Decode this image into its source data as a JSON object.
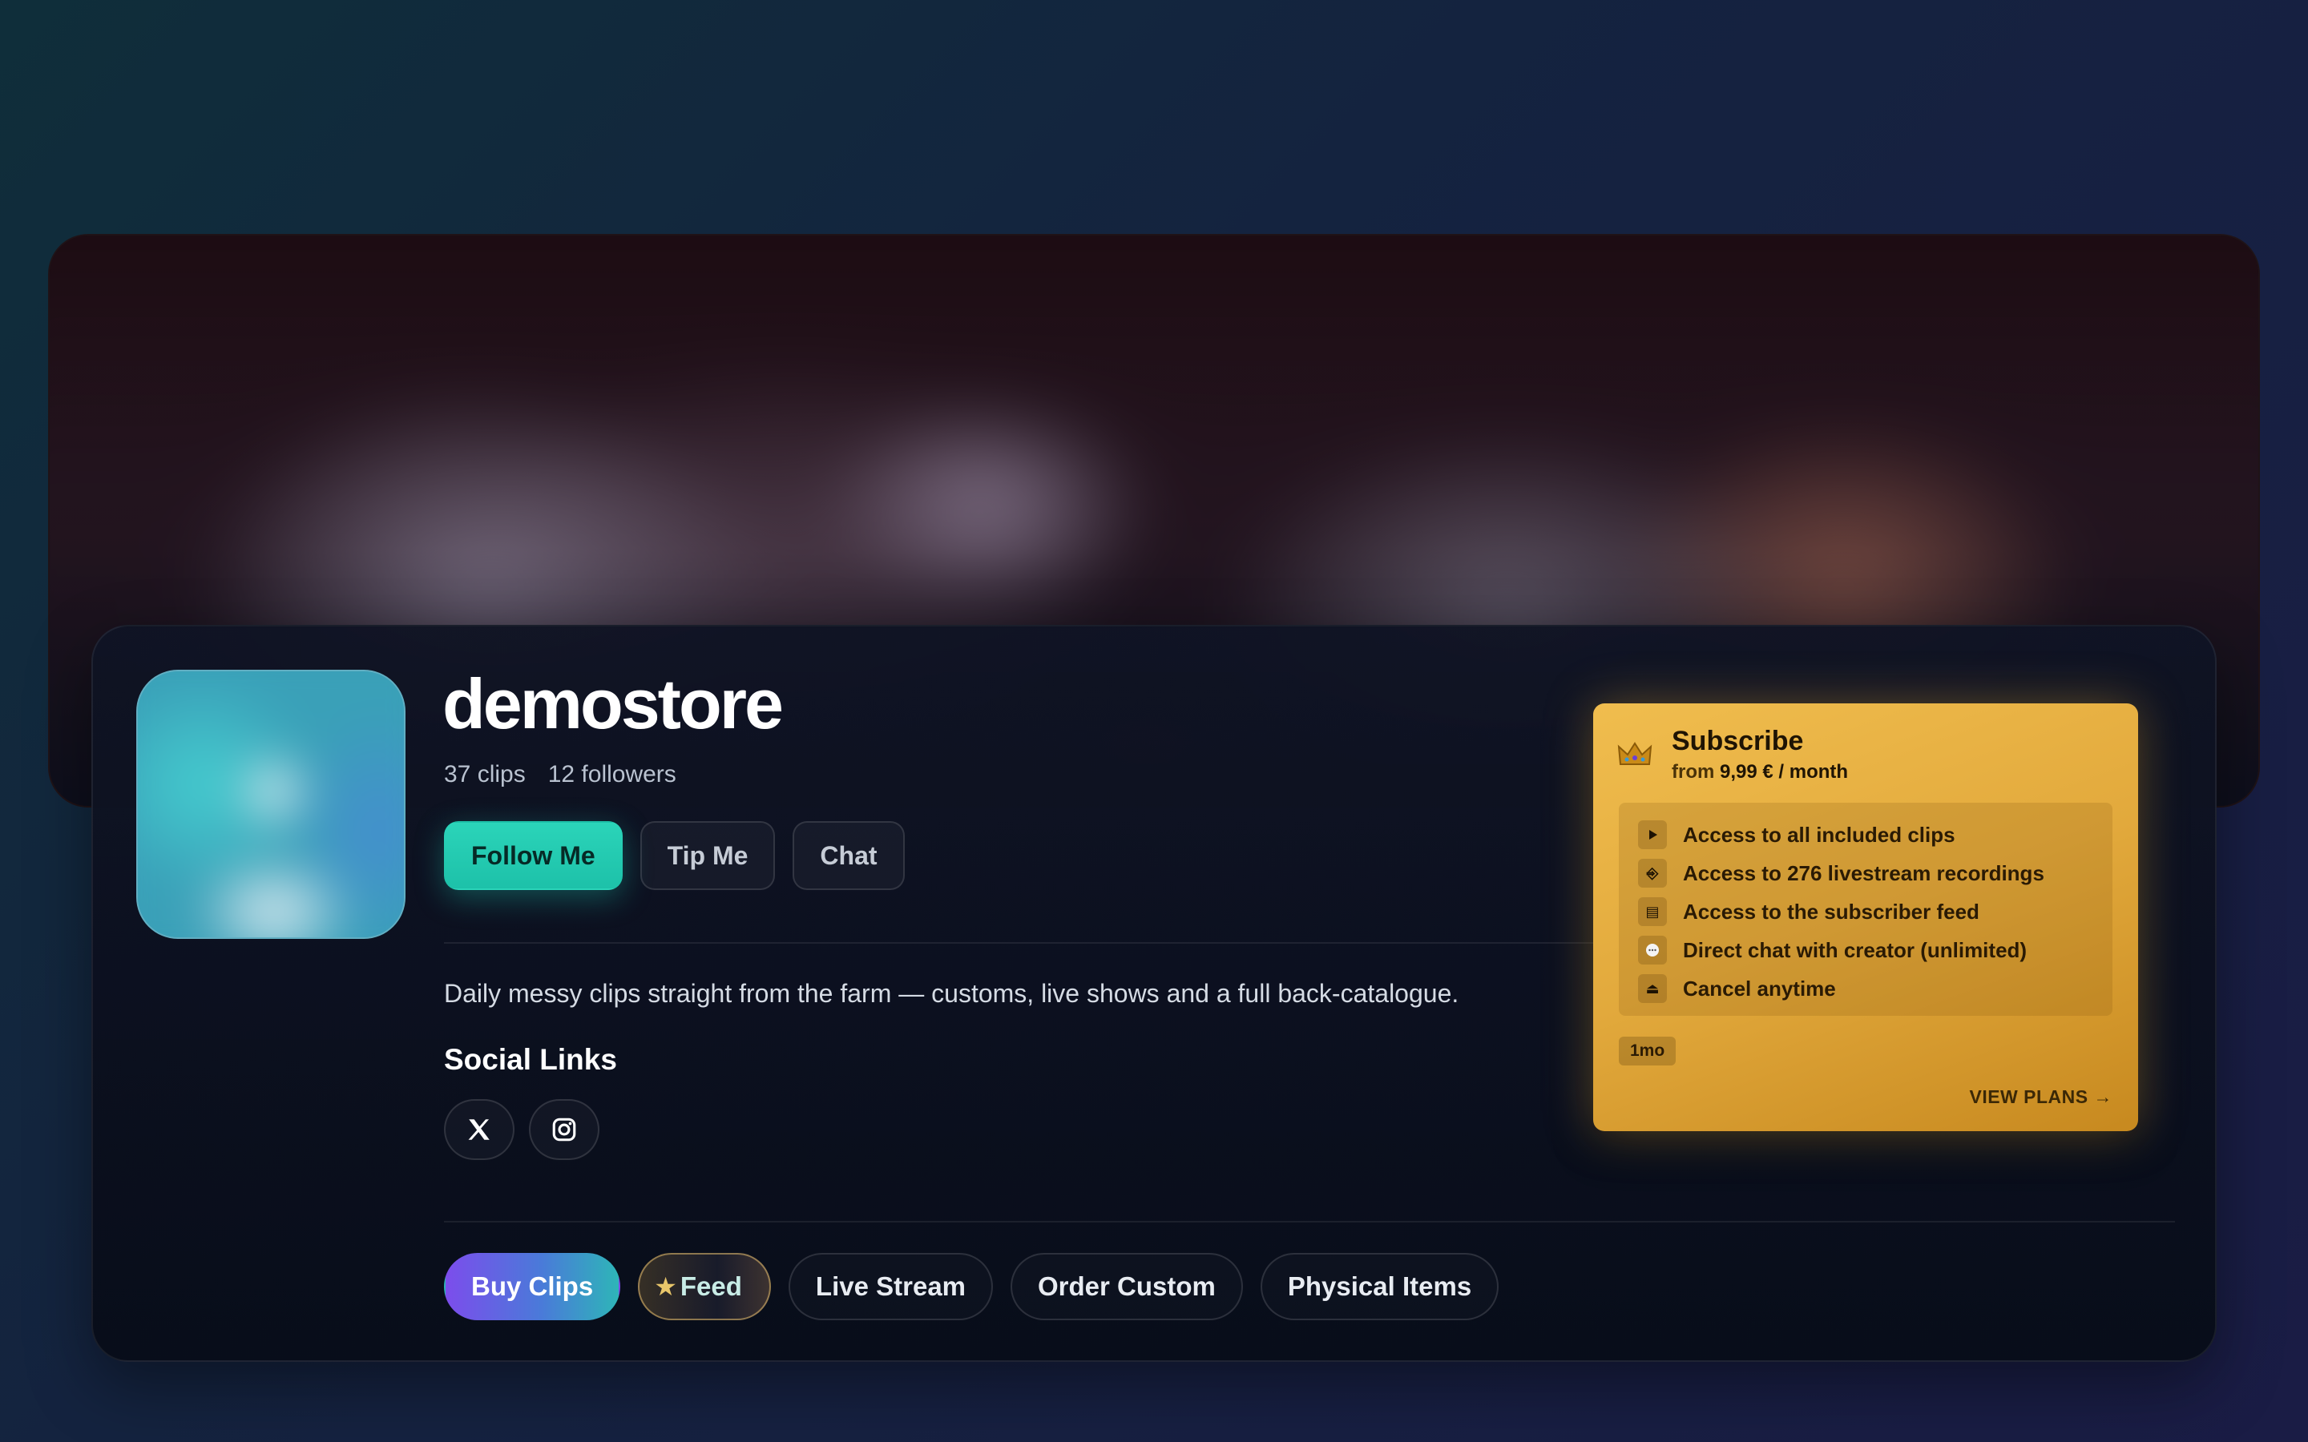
{
  "profile": {
    "name": "demostore",
    "clips": "37 clips",
    "followers": "12 followers",
    "bio": "Daily messy clips straight from the farm — customs, live shows and a full back-catalogue."
  },
  "actions": {
    "follow": "Follow Me",
    "tip": "Tip Me",
    "chat": "Chat"
  },
  "social": {
    "heading": "Social Links",
    "icons": [
      "x-icon",
      "instagram-icon"
    ]
  },
  "tabs": {
    "buy_clips": "Buy Clips",
    "feed": "Feed",
    "live_stream": "Live Stream",
    "order_custom": "Order Custom",
    "physical_items": "Physical Items"
  },
  "subscribe": {
    "title": "Subscribe",
    "price_prefix": "from",
    "price": "9,99 € / month",
    "features": [
      {
        "icon": "play-icon",
        "label": "Access to all included clips"
      },
      {
        "icon": "recording-icon",
        "label": "Access to 276 livestream recordings"
      },
      {
        "icon": "feed-icon",
        "label": "Access to the subscriber feed"
      },
      {
        "icon": "chat-bubble-icon",
        "label": "Direct chat with creator (unlimited)"
      },
      {
        "icon": "eject-icon",
        "label": "Cancel anytime"
      }
    ],
    "duration_badge": "1mo",
    "view_plans": "VIEW PLANS →"
  },
  "colors": {
    "accent_teal": "#1dc1a9",
    "gold": "#e2a93c",
    "tab_gradient_start": "#7c4dec",
    "tab_gradient_end": "#2eb5b8"
  }
}
